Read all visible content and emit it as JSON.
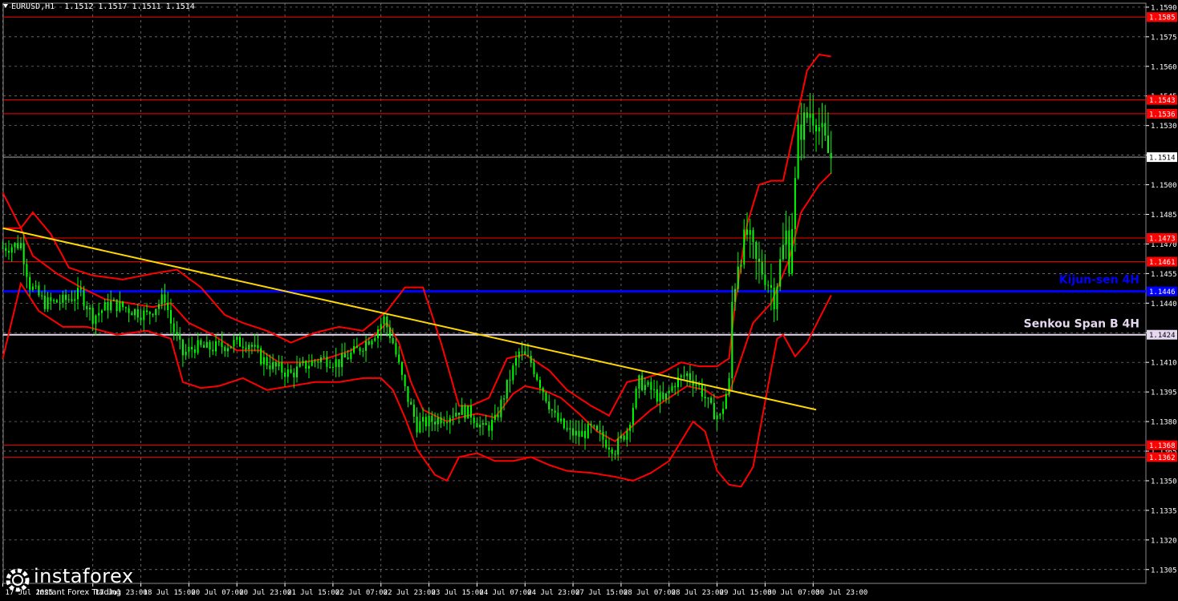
{
  "header": {
    "symbol": "EURUSD,H1",
    "ohlc": "1.1512 1.1517 1.1511 1.1514"
  },
  "branding": {
    "name": "instaforex",
    "tagline": "Instant Forex Trading"
  },
  "colors": {
    "background": "#000000",
    "grid": "#8a8a8a",
    "candles": "#00ff00",
    "levels": "#ff0000",
    "bands": "#ff0000",
    "trendline": "#ffd700",
    "kijun": "#0000ff",
    "senkou": "#e6d7f0",
    "axis_text": "#ffffff"
  },
  "chart_data": {
    "type": "candlestick",
    "y_range": [
      1.1298,
      1.1592
    ],
    "y_ticks": [
      "1.1305",
      "1.1320",
      "1.1335",
      "1.1350",
      "1.1365",
      "1.1380",
      "1.1395",
      "1.1410",
      "1.1425",
      "1.1440",
      "1.1455",
      "1.1470",
      "1.1485",
      "1.1500",
      "1.1515",
      "1.1530",
      "1.1545",
      "1.1560",
      "1.1575",
      "1.1590"
    ],
    "x_ticks": [
      {
        "bar": 0,
        "label": "17 Jul 2025"
      },
      {
        "bar": 30,
        "label": "17 Jul 23:00"
      },
      {
        "bar": 46,
        "label": "18 Jul 15:00"
      },
      {
        "bar": 62,
        "label": "20 Jul 07:00"
      },
      {
        "bar": 78,
        "label": "20 Jul 23:00"
      },
      {
        "bar": 94,
        "label": "21 Jul 15:00"
      },
      {
        "bar": 110,
        "label": "22 Jul 07:00"
      },
      {
        "bar": 126,
        "label": "22 Jul 23:00"
      },
      {
        "bar": 142,
        "label": "23 Jul 15:00"
      },
      {
        "bar": 158,
        "label": "24 Jul 07:00"
      },
      {
        "bar": 174,
        "label": "24 Jul 23:00"
      },
      {
        "bar": 190,
        "label": "27 Jul 15:00"
      },
      {
        "bar": 206,
        "label": "28 Jul 07:00"
      },
      {
        "bar": 222,
        "label": "28 Jul 23:00"
      },
      {
        "bar": 238,
        "label": "29 Jul 15:00"
      },
      {
        "bar": 254,
        "label": "30 Jul 07:00"
      },
      {
        "bar": 270,
        "label": "30 Jul 23:00"
      }
    ],
    "levels": [
      {
        "price": 1.1585,
        "label": "1.1585"
      },
      {
        "price": 1.1543,
        "label": "1.1543"
      },
      {
        "price": 1.1536,
        "label": "1.1536"
      },
      {
        "price": 1.1473,
        "label": "1.1473"
      },
      {
        "price": 1.1461,
        "label": "1.1461"
      },
      {
        "price": 1.1368,
        "label": "1.1368"
      },
      {
        "price": 1.1362,
        "label": "1.1362"
      }
    ],
    "current_price": {
      "price": 1.1514,
      "label": "1.1514"
    },
    "kijun": {
      "price": 1.1446,
      "label": "1.1446",
      "text": "Kijun-sen 4H"
    },
    "senkou": {
      "price": 1.1424,
      "label": "1.1424",
      "text": "Senkou Span B 4H"
    },
    "trendline": {
      "from": {
        "bar": 0,
        "price": 1.1478
      },
      "to": {
        "bar": 271,
        "price": 1.1386
      }
    },
    "price_path": [
      [
        0,
        1.1468
      ],
      [
        6,
        1.147
      ],
      [
        9,
        1.1449
      ],
      [
        14,
        1.144
      ],
      [
        20,
        1.1441
      ],
      [
        26,
        1.1445
      ],
      [
        30,
        1.1433
      ],
      [
        36,
        1.144
      ],
      [
        42,
        1.1437
      ],
      [
        48,
        1.1434
      ],
      [
        54,
        1.1443
      ],
      [
        56,
        1.143
      ],
      [
        60,
        1.1414
      ],
      [
        64,
        1.1418
      ],
      [
        68,
        1.1417
      ],
      [
        72,
        1.1418
      ],
      [
        78,
        1.142
      ],
      [
        82,
        1.142
      ],
      [
        86,
        1.1412
      ],
      [
        90,
        1.1408
      ],
      [
        96,
        1.1404
      ],
      [
        100,
        1.1408
      ],
      [
        106,
        1.1412
      ],
      [
        112,
        1.141
      ],
      [
        118,
        1.1416
      ],
      [
        124,
        1.1425
      ],
      [
        127,
        1.1432
      ],
      [
        130,
        1.142
      ],
      [
        134,
        1.1396
      ],
      [
        138,
        1.1378
      ],
      [
        142,
        1.138
      ],
      [
        148,
        1.1383
      ],
      [
        152,
        1.1386
      ],
      [
        156,
        1.1384
      ],
      [
        160,
        1.1376
      ],
      [
        164,
        1.138
      ],
      [
        168,
        1.1398
      ],
      [
        172,
        1.1415
      ],
      [
        176,
        1.141
      ],
      [
        180,
        1.1396
      ],
      [
        184,
        1.1382
      ],
      [
        188,
        1.1375
      ],
      [
        192,
        1.1373
      ],
      [
        196,
        1.1376
      ],
      [
        200,
        1.1371
      ],
      [
        204,
        1.1366
      ],
      [
        208,
        1.1376
      ],
      [
        212,
        1.14
      ],
      [
        216,
        1.1396
      ],
      [
        220,
        1.139
      ],
      [
        224,
        1.14
      ],
      [
        228,
        1.1404
      ],
      [
        232,
        1.1398
      ],
      [
        236,
        1.1386
      ],
      [
        239,
        1.1382
      ],
      [
        242,
        1.14
      ],
      [
        243,
        1.144
      ],
      [
        245,
        1.1462
      ],
      [
        248,
        1.1475
      ],
      [
        251,
        1.146
      ],
      [
        254,
        1.1455
      ],
      [
        257,
        1.1444
      ],
      [
        259,
        1.146
      ],
      [
        261,
        1.1475
      ],
      [
        262,
        1.1462
      ],
      [
        264,
        1.15
      ],
      [
        265,
        1.1525
      ],
      [
        267,
        1.1532
      ],
      [
        269,
        1.1537
      ],
      [
        271,
        1.1534
      ],
      [
        273,
        1.1525
      ],
      [
        275,
        1.1516
      ],
      [
        276,
        1.1514
      ]
    ],
    "band_upper": [
      [
        0,
        1.1496
      ],
      [
        6,
        1.1478
      ],
      [
        10,
        1.1486
      ],
      [
        16,
        1.1475
      ],
      [
        22,
        1.1458
      ],
      [
        30,
        1.1454
      ],
      [
        40,
        1.1452
      ],
      [
        50,
        1.1455
      ],
      [
        58,
        1.1457
      ],
      [
        66,
        1.1448
      ],
      [
        74,
        1.1434
      ],
      [
        80,
        1.143
      ],
      [
        88,
        1.1426
      ],
      [
        96,
        1.142
      ],
      [
        104,
        1.1425
      ],
      [
        112,
        1.1428
      ],
      [
        120,
        1.1426
      ],
      [
        128,
        1.1436
      ],
      [
        134,
        1.1448
      ],
      [
        140,
        1.1448
      ],
      [
        146,
        1.142
      ],
      [
        152,
        1.1388
      ],
      [
        156,
        1.1388
      ],
      [
        162,
        1.1392
      ],
      [
        168,
        1.1412
      ],
      [
        174,
        1.1414
      ],
      [
        182,
        1.1406
      ],
      [
        188,
        1.1396
      ],
      [
        196,
        1.1388
      ],
      [
        202,
        1.1383
      ],
      [
        208,
        1.14
      ],
      [
        214,
        1.1402
      ],
      [
        220,
        1.1405
      ],
      [
        226,
        1.141
      ],
      [
        232,
        1.1408
      ],
      [
        238,
        1.1408
      ],
      [
        242,
        1.1412
      ],
      [
        244,
        1.144
      ],
      [
        248,
        1.148
      ],
      [
        252,
        1.15
      ],
      [
        256,
        1.1502
      ],
      [
        260,
        1.1502
      ],
      [
        264,
        1.153
      ],
      [
        268,
        1.1558
      ],
      [
        272,
        1.1566
      ],
      [
        276,
        1.1565
      ]
    ],
    "band_lower": [
      [
        0,
        1.1412
      ],
      [
        6,
        1.145
      ],
      [
        12,
        1.1436
      ],
      [
        20,
        1.1428
      ],
      [
        28,
        1.1428
      ],
      [
        38,
        1.1424
      ],
      [
        48,
        1.1426
      ],
      [
        56,
        1.1422
      ],
      [
        60,
        1.14
      ],
      [
        66,
        1.1397
      ],
      [
        72,
        1.1398
      ],
      [
        80,
        1.1402
      ],
      [
        88,
        1.1396
      ],
      [
        96,
        1.1398
      ],
      [
        104,
        1.14
      ],
      [
        112,
        1.14
      ],
      [
        120,
        1.1402
      ],
      [
        126,
        1.1402
      ],
      [
        130,
        1.1396
      ],
      [
        134,
        1.1382
      ],
      [
        138,
        1.1366
      ],
      [
        144,
        1.1353
      ],
      [
        148,
        1.135
      ],
      [
        152,
        1.1362
      ],
      [
        158,
        1.1364
      ],
      [
        164,
        1.136
      ],
      [
        170,
        1.136
      ],
      [
        176,
        1.1362
      ],
      [
        182,
        1.1358
      ],
      [
        188,
        1.1355
      ],
      [
        196,
        1.1354
      ],
      [
        204,
        1.1352
      ],
      [
        210,
        1.135
      ],
      [
        216,
        1.1354
      ],
      [
        222,
        1.136
      ],
      [
        226,
        1.137
      ],
      [
        230,
        1.138
      ],
      [
        234,
        1.1375
      ],
      [
        238,
        1.1355
      ],
      [
        242,
        1.1348
      ],
      [
        246,
        1.1347
      ],
      [
        250,
        1.1357
      ],
      [
        254,
        1.139
      ],
      [
        258,
        1.1422
      ],
      [
        260,
        1.1424
      ],
      [
        264,
        1.1413
      ],
      [
        268,
        1.142
      ],
      [
        272,
        1.1432
      ],
      [
        276,
        1.1444
      ]
    ],
    "base_mid": [
      [
        0,
        1.1478
      ],
      [
        6,
        1.1478
      ],
      [
        10,
        1.1464
      ],
      [
        18,
        1.1455
      ],
      [
        26,
        1.1448
      ],
      [
        34,
        1.1442
      ],
      [
        42,
        1.144
      ],
      [
        50,
        1.1438
      ],
      [
        56,
        1.144
      ],
      [
        62,
        1.143
      ],
      [
        70,
        1.1424
      ],
      [
        78,
        1.1416
      ],
      [
        86,
        1.1416
      ],
      [
        92,
        1.141
      ],
      [
        100,
        1.141
      ],
      [
        108,
        1.1412
      ],
      [
        116,
        1.1416
      ],
      [
        124,
        1.1424
      ],
      [
        128,
        1.143
      ],
      [
        132,
        1.142
      ],
      [
        136,
        1.14
      ],
      [
        140,
        1.1386
      ],
      [
        144,
        1.1383
      ],
      [
        148,
        1.138
      ],
      [
        152,
        1.1382
      ],
      [
        158,
        1.1384
      ],
      [
        164,
        1.1382
      ],
      [
        170,
        1.1394
      ],
      [
        174,
        1.1398
      ],
      [
        180,
        1.1396
      ],
      [
        186,
        1.1392
      ],
      [
        192,
        1.1384
      ],
      [
        198,
        1.1375
      ],
      [
        204,
        1.137
      ],
      [
        210,
        1.1378
      ],
      [
        216,
        1.1386
      ],
      [
        222,
        1.1392
      ],
      [
        228,
        1.1398
      ],
      [
        234,
        1.1396
      ],
      [
        238,
        1.1392
      ],
      [
        242,
        1.1394
      ],
      [
        246,
        1.1412
      ],
      [
        250,
        1.143
      ],
      [
        256,
        1.144
      ],
      [
        262,
        1.1462
      ],
      [
        266,
        1.1486
      ],
      [
        272,
        1.15
      ],
      [
        276,
        1.1506
      ]
    ]
  }
}
